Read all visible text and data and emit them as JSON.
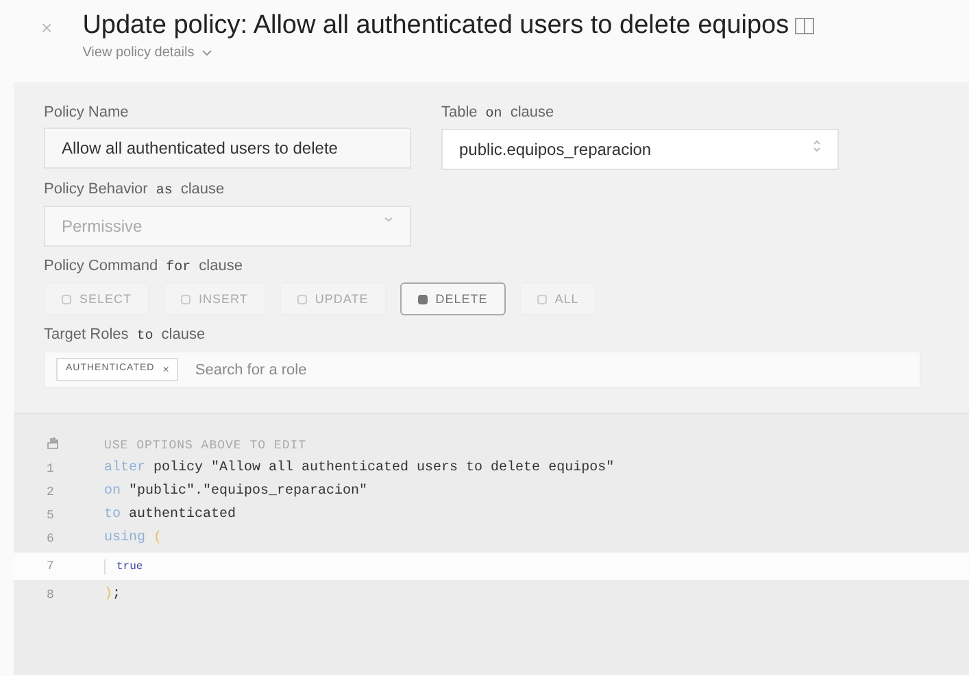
{
  "header": {
    "close": "×",
    "title": "Update policy: Allow all authenticated users to delete equipos",
    "details_link": "View policy details"
  },
  "form": {
    "policy_name": {
      "label": "Policy Name",
      "value": "Allow all authenticated users to delete"
    },
    "table": {
      "label": "Table",
      "keyword": "on",
      "suffix": "clause",
      "value": "public.equipos_reparacion"
    },
    "behavior": {
      "label": "Policy Behavior",
      "keyword": "as",
      "suffix": "clause",
      "value": "Permissive"
    },
    "command": {
      "label": "Policy Command",
      "keyword": "for",
      "suffix": "clause",
      "options": [
        {
          "label": "SELECT",
          "selected": false
        },
        {
          "label": "INSERT",
          "selected": false
        },
        {
          "label": "UPDATE",
          "selected": false
        },
        {
          "label": "DELETE",
          "selected": true
        },
        {
          "label": "ALL",
          "selected": false
        }
      ]
    },
    "roles": {
      "label": "Target Roles",
      "keyword": "to",
      "suffix": "clause",
      "tags": [
        "AUTHENTICATED"
      ],
      "tag_remove": "×",
      "placeholder": "Search for a role"
    }
  },
  "editor": {
    "hint": "USE OPTIONS ABOVE TO EDIT",
    "lines": [
      {
        "number": "1",
        "highlighted": false,
        "tokens": [
          {
            "kind": "keyword",
            "text": "alter"
          },
          {
            "kind": "plain",
            "text": " policy \"Allow all authenticated users to delete equipos\""
          }
        ]
      },
      {
        "number": "2",
        "highlighted": false,
        "tokens": [
          {
            "kind": "keyword",
            "text": "on"
          },
          {
            "kind": "plain",
            "text": " \"public\".\"equipos_reparacion\""
          }
        ]
      },
      {
        "number": "5",
        "highlighted": false,
        "tokens": [
          {
            "kind": "keyword",
            "text": "to"
          },
          {
            "kind": "plain",
            "text": " authenticated"
          }
        ]
      },
      {
        "number": "6",
        "highlighted": false,
        "tokens": [
          {
            "kind": "keyword",
            "text": "using"
          },
          {
            "kind": "paren",
            "text": " ("
          }
        ]
      },
      {
        "number": "7",
        "highlighted": true,
        "tokens": [
          {
            "kind": "literal",
            "text": "true"
          }
        ]
      },
      {
        "number": "8",
        "highlighted": false,
        "tokens": [
          {
            "kind": "paren",
            "text": ")"
          },
          {
            "kind": "plain",
            "text": ";"
          }
        ]
      }
    ]
  }
}
